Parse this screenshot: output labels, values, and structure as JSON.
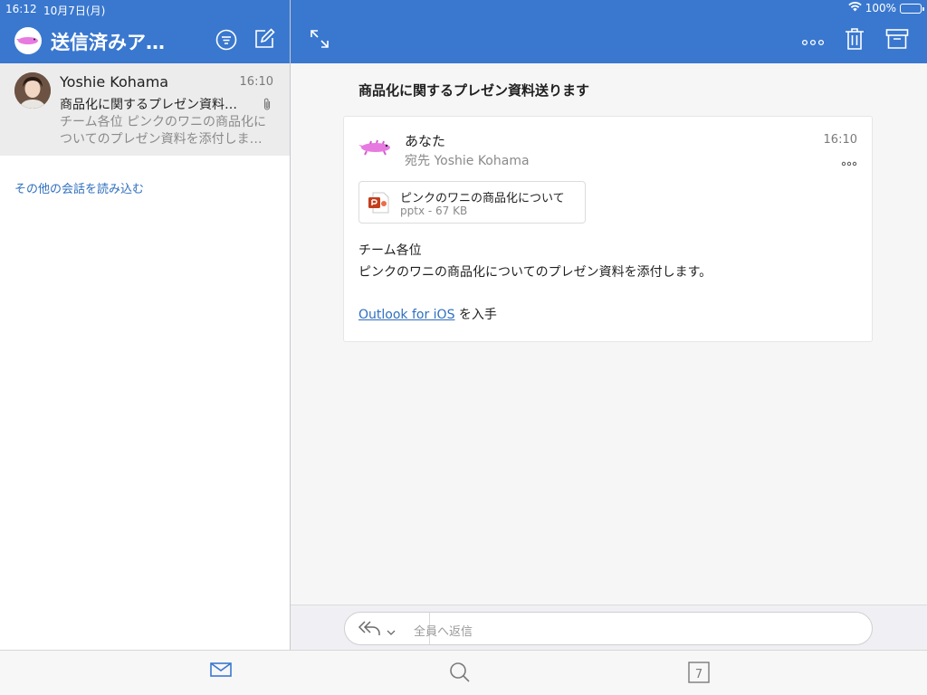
{
  "status_bar": {
    "time": "16:12",
    "date": "10月7日(月)",
    "battery": "100%",
    "battery_level": 1.0
  },
  "header": {
    "folder_title": "送信済みア…",
    "icons": [
      "filter-icon",
      "compose-icon",
      "expand-icon",
      "more-icon",
      "trash-icon",
      "archive-icon"
    ]
  },
  "message_list": {
    "items": [
      {
        "sender": "Yoshie Kohama",
        "time": "16:10",
        "subject": "商品化に関するプレゼン資料…",
        "preview": "チーム各位 ピンクのワニの商品化についてのプレゼン資料を添付しま…",
        "has_attachment": true
      }
    ],
    "load_more": "その他の会話を読み込む"
  },
  "reading_pane": {
    "subject": "商品化に関するプレゼン資料送ります",
    "from": "あなた",
    "to": "宛先 Yoshie Kohama",
    "time": "16:10",
    "attachment": {
      "name": "ピンクのワニの商品化について",
      "meta": "pptx - 67 KB"
    },
    "body_line1": "チーム各位",
    "body_line2": "ピンクのワニの商品化についてのプレゼン資料を添付します。",
    "signature_link": "Outlook for iOS",
    "signature_suffix": " を入手"
  },
  "reply": {
    "placeholder": "全員へ返信"
  },
  "tab_bar": {
    "calendar_day": "7",
    "active_color": "#3a78cf"
  },
  "colors": {
    "accent": "#3a78cf",
    "link": "#2f6fbf",
    "croc_pink": "#e77ae0"
  }
}
